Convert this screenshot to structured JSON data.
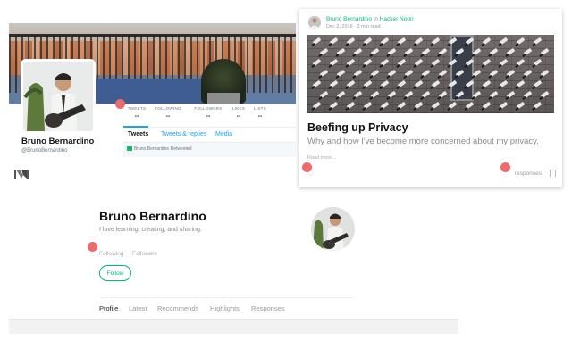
{
  "twitter": {
    "stats": [
      {
        "label": "TWEETS",
        "value": "--"
      },
      {
        "label": "FOLLOWING",
        "value": "--"
      },
      {
        "label": "FOLLOWERS",
        "value": "--"
      },
      {
        "label": "LIKES",
        "value": "--"
      },
      {
        "label": "LISTS",
        "value": "--"
      }
    ],
    "name": "Bruno Bernardino",
    "handle": "@BrunoBernardino",
    "tabs": [
      "Tweets",
      "Tweets & replies",
      "Media"
    ],
    "retweet_text": "Bruno Bernardino Retweeted",
    "accent_color": "#1da1f2"
  },
  "card": {
    "author": "Bruno Bernardino",
    "in_word": "in",
    "publication": "Hacker Noon",
    "meta": "Dec 2, 2016 · 3 min read",
    "title": "Beefing up Privacy",
    "subtitle": "Why and how I've become more concerned about my privacy.",
    "read_more": "Read more…",
    "responses": "responses",
    "accent_color": "#02b875"
  },
  "profile": {
    "name": "Bruno Bernardino",
    "bio": "I love learning, creating, and sharing.",
    "following": "Following",
    "followers": "Followers",
    "follow_label": "Follow",
    "tabs": [
      "Profile",
      "Latest",
      "Recommends",
      "Highlights",
      "Responses"
    ]
  },
  "marker_color": "#ef6a6a"
}
